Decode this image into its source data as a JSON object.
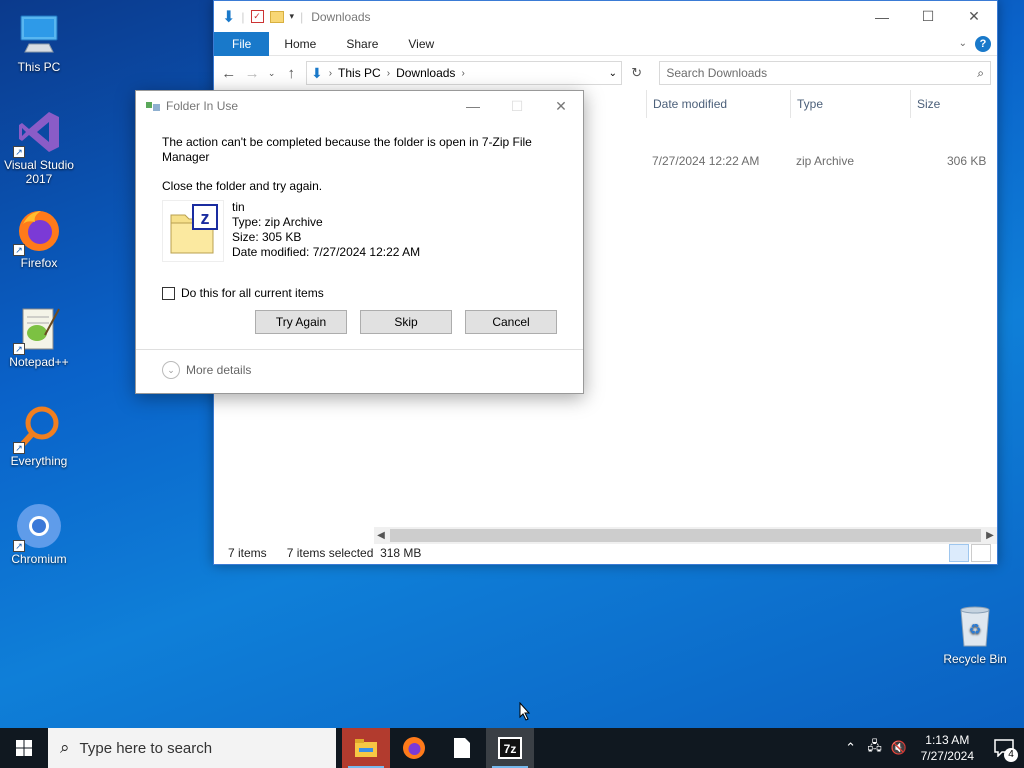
{
  "desktop": {
    "icons": [
      {
        "label": "This PC"
      },
      {
        "label": "Visual Studio 2017"
      },
      {
        "label": "Firefox"
      },
      {
        "label": "Notepad++"
      },
      {
        "label": "Everything"
      },
      {
        "label": "Chromium"
      },
      {
        "label": "Recycle Bin"
      }
    ]
  },
  "explorer": {
    "title": "Downloads",
    "tabs": [
      "File",
      "Home",
      "Share",
      "View"
    ],
    "breadcrumb": [
      "This PC",
      "Downloads"
    ],
    "search_placeholder": "Search Downloads",
    "columns": {
      "date": "Date modified",
      "type": "Type",
      "size": "Size"
    },
    "row": {
      "date": "7/27/2024 12:22 AM",
      "type": "zip Archive",
      "size": "306 KB"
    },
    "status": {
      "items": "7 items",
      "selected": "7 items selected",
      "size": "318 MB"
    }
  },
  "dialog": {
    "title": "Folder In Use",
    "message": "The action can't be completed because the folder is open in 7-Zip File Manager",
    "instruction": "Close the folder and try again.",
    "file": {
      "name": "tin",
      "type": "Type: zip Archive",
      "size": "Size: 305 KB",
      "modified": "Date modified: 7/27/2024 12:22 AM"
    },
    "checkbox_label": "Do this for all current items",
    "buttons": {
      "try_again": "Try Again",
      "skip": "Skip",
      "cancel": "Cancel"
    },
    "more_details": "More details"
  },
  "taskbar": {
    "search_placeholder": "Type here to search",
    "clock": {
      "time": "1:13 AM",
      "date": "7/27/2024"
    },
    "notification_count": "4"
  },
  "colors": {
    "accent": "#1979ca",
    "taskbar": "#101820"
  }
}
